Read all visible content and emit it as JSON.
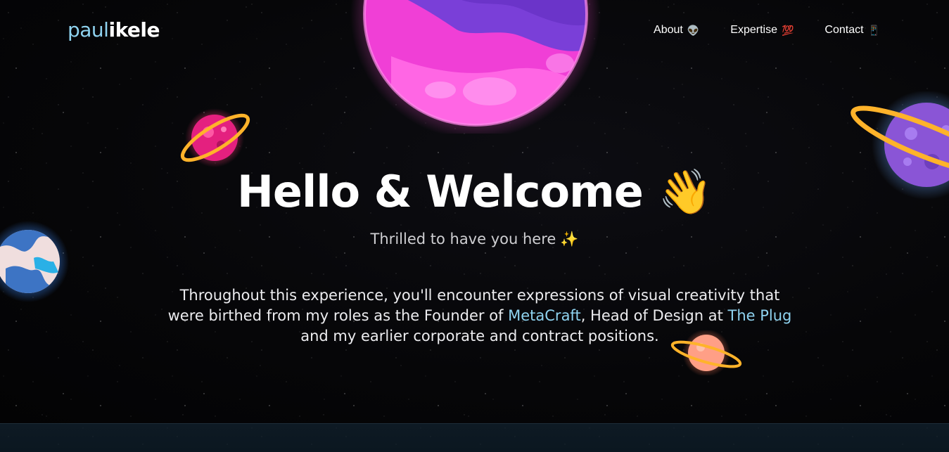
{
  "header": {
    "logo": {
      "part1": "paul",
      "part2": "ikele"
    },
    "nav": [
      {
        "label": "About",
        "icon": "alien-icon",
        "glyph": "👽"
      },
      {
        "label": "Expertise",
        "icon": "hundred-points-icon",
        "glyph": "💯"
      },
      {
        "label": "Contact",
        "icon": "mobile-phone-icon",
        "glyph": "📱"
      }
    ]
  },
  "hero": {
    "title": "Hello & Welcome",
    "title_icon": "👋",
    "subtitle": "Thrilled to have you here",
    "subtitle_icon": "✨",
    "para": {
      "t1": "Throughout this experience, you'll encounter expressions of visual creativity that were birthed from my roles as the Founder of ",
      "link1": "MetaCraft",
      "t2": ", Head of Design at ",
      "link2": "The Plug",
      "t3": " and my earlier corporate and contract positions."
    }
  },
  "colors": {
    "accent": "#8fd3f0",
    "background": "#050507",
    "text": "#ffffff"
  }
}
